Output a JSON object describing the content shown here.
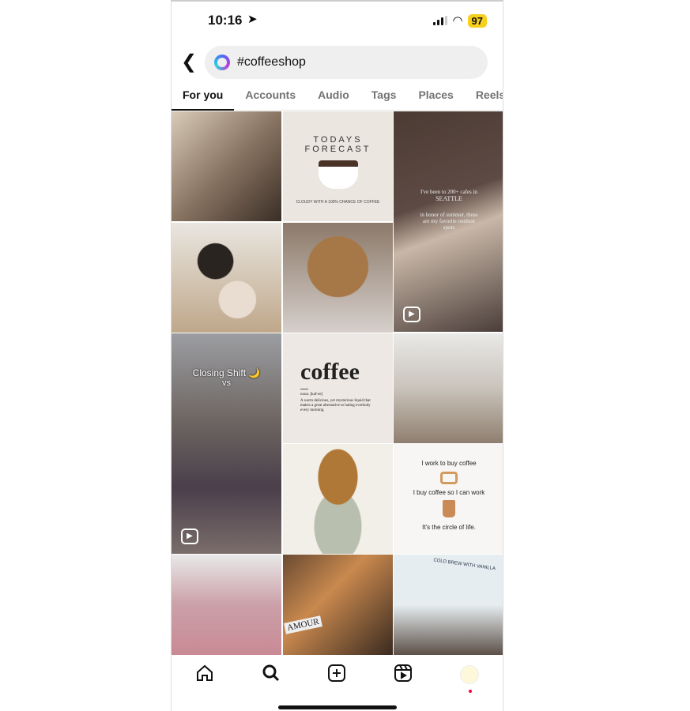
{
  "status": {
    "time": "10:16",
    "battery": "97"
  },
  "search": {
    "query": "#coffeeshop"
  },
  "tabs": [
    "For you",
    "Accounts",
    "Audio",
    "Tags",
    "Places",
    "Reels"
  ],
  "tiles": {
    "forecast_title": "TODAYS FORECAST",
    "forecast_sub": "CLOUDY WITH A 100% CHANCE OF COFFEE",
    "seattle_1": "I've been to 200+ cafes in",
    "seattle_2": "SEATTLE",
    "seattle_3": "in honor of summer, these are my favorite outdoor spots",
    "closing": "Closing Shift 🌙",
    "vs": "vs",
    "coffee_word": "coffee",
    "coffee_pron": "noun. [kaf-ee]",
    "coffee_def": "A warm delicious, yet mysterious liquid that makes a great alternative to hating everbody every morning.",
    "circle_1": "I work to buy coffee",
    "circle_2": "I buy coffee so I can work",
    "circle_3": "It's the circle of life.",
    "amour": "AMOUR",
    "cold_brew": "COLD BREW WITH VANILLA"
  },
  "nav": [
    "home",
    "search",
    "create",
    "reels",
    "profile"
  ],
  "colors": {
    "battery": "#f7cf1d",
    "notification": "#ff0033"
  }
}
